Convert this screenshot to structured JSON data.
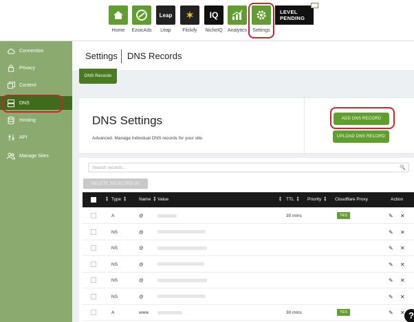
{
  "topnav": {
    "items": [
      {
        "label": "Home",
        "icon": "home-icon",
        "color": "#5f9e2f"
      },
      {
        "label": "EzoicAds",
        "icon": "ezoic-ads-icon",
        "color": "#5f9e2f"
      },
      {
        "label": "Leap",
        "icon": "leap-icon",
        "color": "#222222",
        "glyph": "Leap"
      },
      {
        "label": "Flickify",
        "icon": "flickify-icon",
        "color": "#222222",
        "glyph": "✶"
      },
      {
        "label": "NicheIQ",
        "icon": "nicheiq-icon",
        "color": "#111111",
        "glyph": "IQ"
      },
      {
        "label": "Analytics",
        "icon": "analytics-icon",
        "color": "#5f9e2f"
      },
      {
        "label": "Settings",
        "icon": "settings-gear-icon",
        "color": "#5f9e2f"
      }
    ],
    "level_badge": {
      "line1": "LEVEL",
      "line2": "PENDING"
    }
  },
  "sidebar": {
    "items": [
      {
        "label": "Connection",
        "icon": "cloud-icon"
      },
      {
        "label": "Privacy",
        "icon": "lock-icon"
      },
      {
        "label": "Content",
        "icon": "content-pages-icon"
      },
      {
        "label": "DNS",
        "icon": "server-icon",
        "active": true
      },
      {
        "label": "Hosting",
        "icon": "database-icon"
      },
      {
        "label": "API",
        "icon": "api-icon"
      },
      {
        "label": "Manage Sites",
        "icon": "users-icon"
      }
    ]
  },
  "header": {
    "title": "Settings",
    "subtitle": "DNS Records"
  },
  "subtab": {
    "label": "DNS Records"
  },
  "dns_card": {
    "title": "DNS Settings",
    "description": "Advanced. Manage individual DNS records for your site.",
    "add_button": "ADD DNS RECORD",
    "upload_button": "UPLOAD DNS RECORD"
  },
  "table": {
    "search_placeholder": "Search records...",
    "delete_selected": "DELETE SELECTED (0)",
    "columns": {
      "type": "Type",
      "name": "Name",
      "value": "Value",
      "ttl": "TTL",
      "priority": "Priority",
      "proxy": "Cloudflare Proxy",
      "action": "Action"
    },
    "rows": [
      {
        "type": "A",
        "name": "@",
        "ttl": "30 mins",
        "proxy": "YES"
      },
      {
        "type": "NS",
        "name": "@",
        "ttl": "",
        "proxy": ""
      },
      {
        "type": "NS",
        "name": "@",
        "ttl": "",
        "proxy": ""
      },
      {
        "type": "NS",
        "name": "@",
        "ttl": "",
        "proxy": ""
      },
      {
        "type": "NS",
        "name": "@",
        "ttl": "",
        "proxy": ""
      },
      {
        "type": "NS",
        "name": "@",
        "ttl": "",
        "proxy": ""
      },
      {
        "type": "A",
        "name": "www",
        "ttl": "30 mins",
        "proxy": "YES"
      }
    ]
  },
  "help": {
    "label": "?"
  },
  "colors": {
    "brand_green": "#5f9e2f",
    "sidebar": "#8aaa70",
    "sidebar_active": "#3f6b1d",
    "highlight": "#d0202c"
  }
}
